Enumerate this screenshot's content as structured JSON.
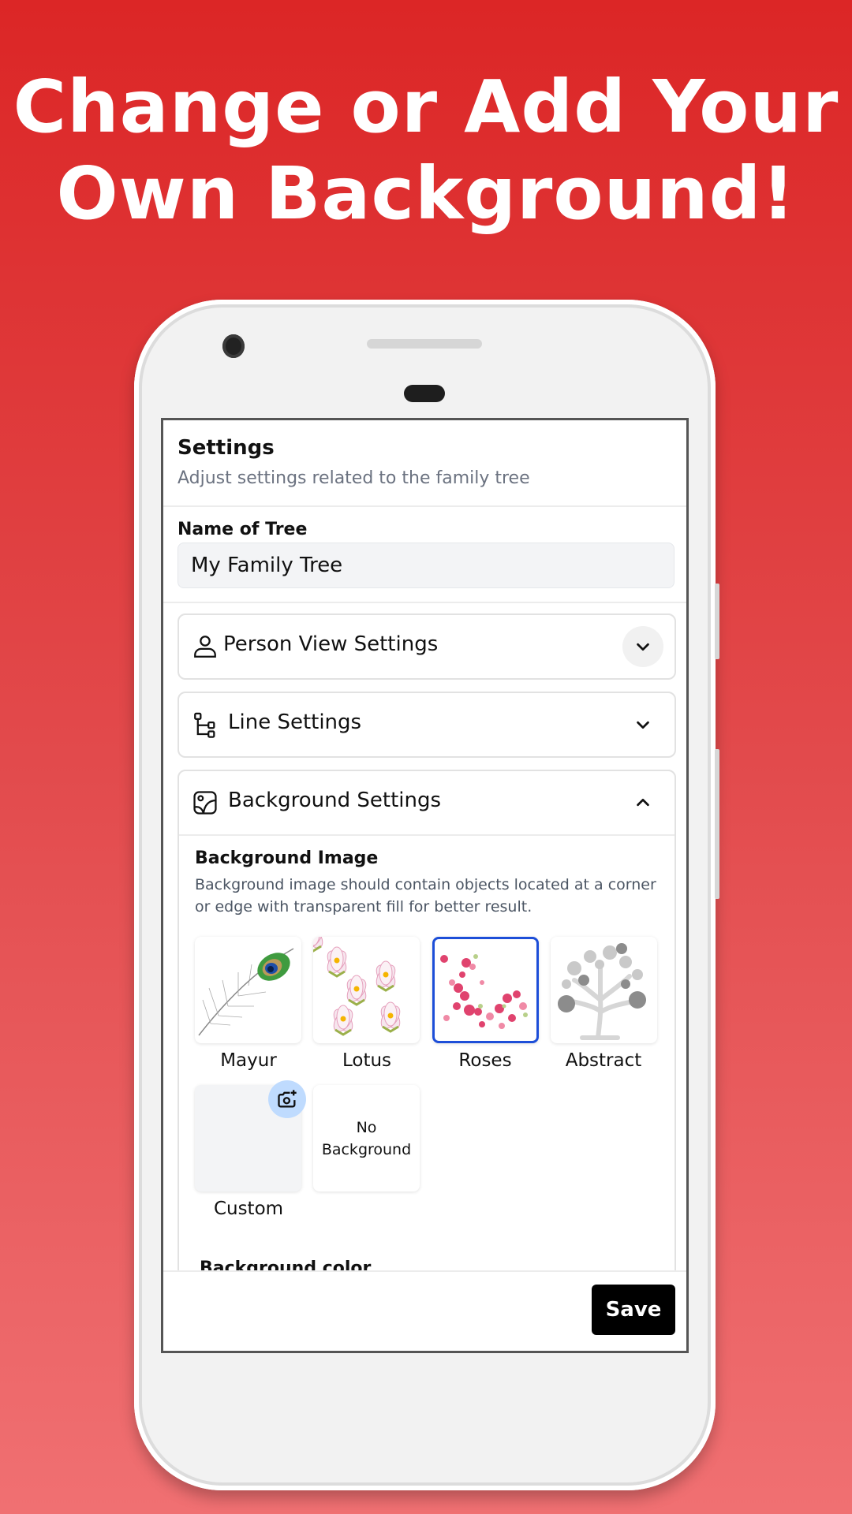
{
  "promo": {
    "line1": "Change or Add Your",
    "line2": "Own Background!"
  },
  "header": {
    "title": "Settings",
    "subtitle": "Adjust settings related to the family tree"
  },
  "tree_name": {
    "label": "Name of Tree",
    "value": "My Family Tree"
  },
  "sections": [
    {
      "label": "Person View Settings",
      "icon": "person-icon",
      "expanded": false
    },
    {
      "label": "Line Settings",
      "icon": "tree-structure-icon",
      "expanded": false
    },
    {
      "label": "Background Settings",
      "icon": "image-icon",
      "expanded": true
    }
  ],
  "background": {
    "image_title": "Background Image",
    "image_desc": "Background image should contain objects located at a corner or edge with transparent fill for better result.",
    "options": [
      {
        "label": "Mayur",
        "selected": false
      },
      {
        "label": "Lotus",
        "selected": false
      },
      {
        "label": "Roses",
        "selected": true
      },
      {
        "label": "Abstract",
        "selected": false
      },
      {
        "label": "Custom",
        "selected": false,
        "action_icon": "add-photo-icon"
      },
      {
        "label": "No Background",
        "selected": false
      }
    ],
    "no_bg_line1": "No",
    "no_bg_line2": "Background",
    "color_title": "Background color",
    "selected_color": "#1d4ed8"
  },
  "footer": {
    "save_label": "Save"
  },
  "colors": {
    "accent": "#1d4ed8",
    "promo_bg_top": "#dc2626",
    "promo_bg_bottom": "#f07072"
  }
}
